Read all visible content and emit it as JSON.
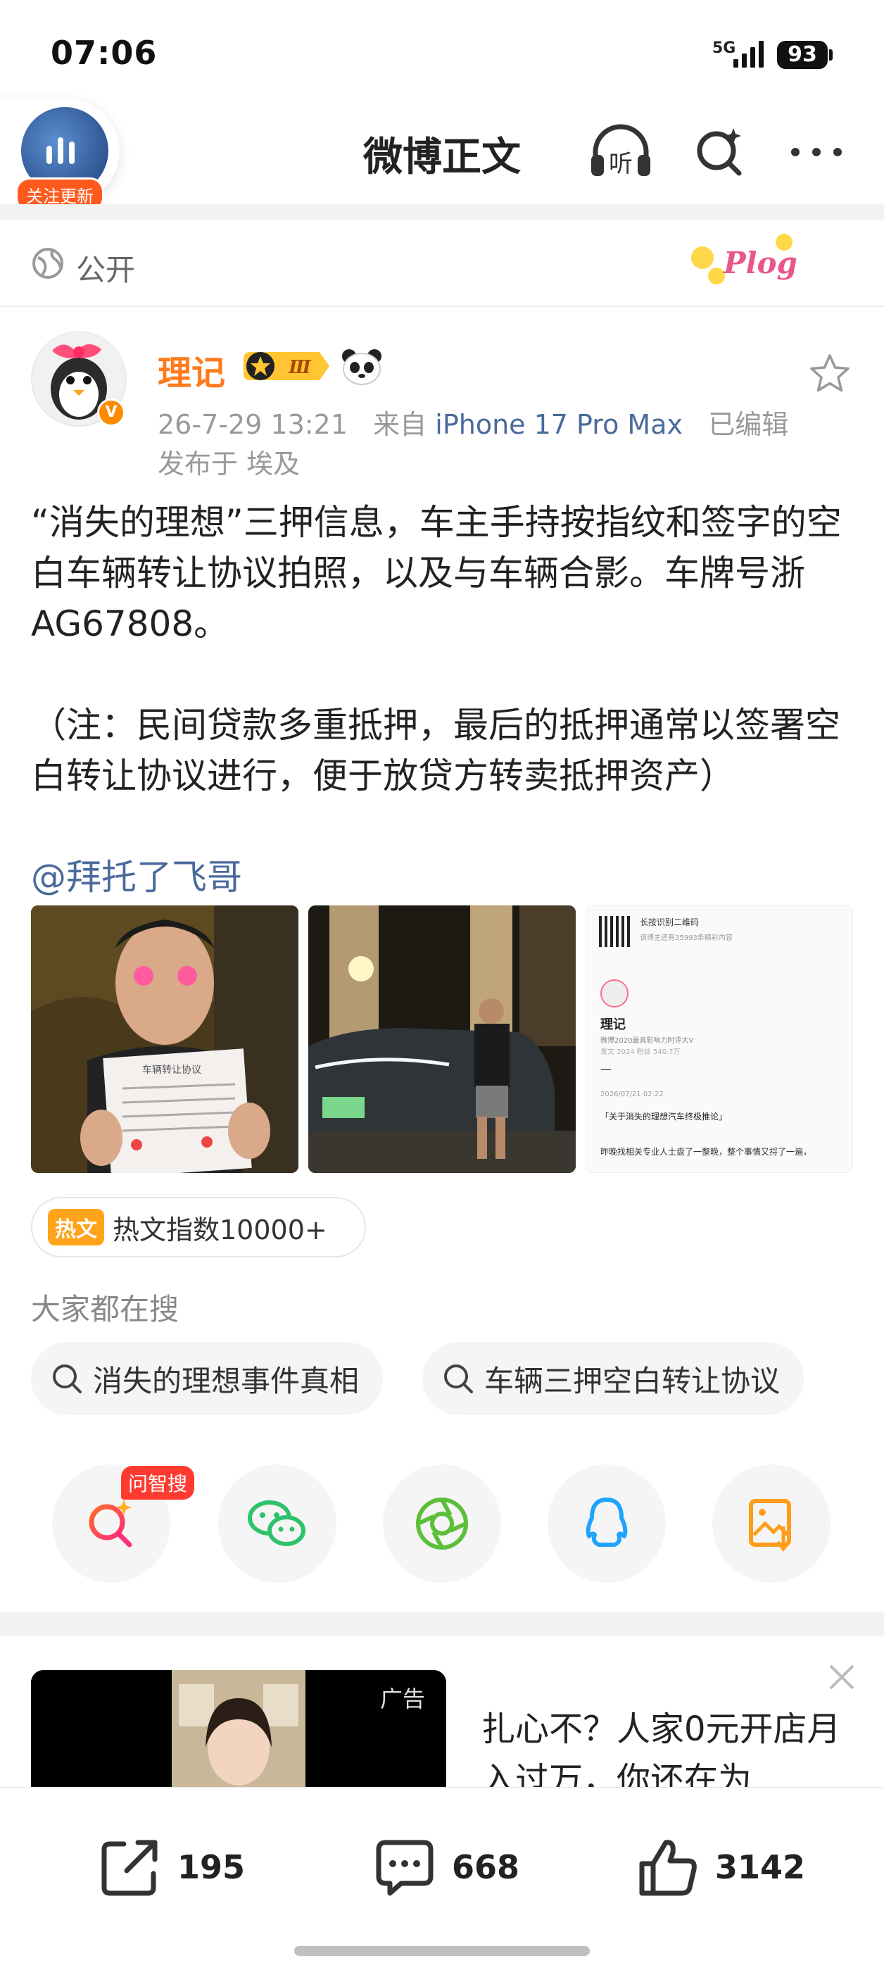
{
  "status_bar": {
    "time": "07:06",
    "network": "5G",
    "battery": "93"
  },
  "nav": {
    "title": "微博正文",
    "follow_badge": "关注更新",
    "icons": [
      "listen-icon",
      "search-ai-icon",
      "more-icon"
    ]
  },
  "visibility": {
    "label": "公开",
    "sticker_text": "Plog"
  },
  "author": {
    "name": "理记",
    "vip_level": "Ⅲ",
    "meta": {
      "date": "26-7-29 13:21",
      "source_prefix": "来自",
      "device": "iPhone 17 Pro Max",
      "edited": "已编辑",
      "location": "发布于 埃及"
    }
  },
  "post": {
    "paragraph1": "“消失的理想”三押信息，车主手持按指纹和签字的空白车辆转让协议拍照，以及与车辆合影。车牌号浙AG67808。",
    "paragraph2": "（注：民间贷款多重抵押，最后的抵押通常以签署空白转让协议进行，便于放贷方转卖抵押资产）",
    "mention": "@拜托了飞哥",
    "image3": {
      "qr_title": "长按识别二维码",
      "qr_subtitle": "该博主还有35993条精彩内容",
      "name": "理记",
      "line1": "微博2020最具影响力时评大V",
      "line2": "发文 2024   粉丝 540.7万",
      "dash": "—",
      "date": "2026/07/21 02:22",
      "headline": "「关于消失的理想汽车终极推论」",
      "body": "昨晚找相关专业人士盘了一整晚，整个事情又捋了一遍，"
    },
    "doc_title": "车辆转让协议"
  },
  "hot": {
    "tag": "热文",
    "text": "热文指数10000+"
  },
  "search": {
    "title": "大家都在搜",
    "chips": [
      "消失的理想事件真相",
      "车辆三押空白转让协议"
    ]
  },
  "share": {
    "badge": "问智搜",
    "buttons": [
      "ai-search-icon",
      "wechat-icon",
      "moments-icon",
      "qq-icon",
      "save-image-icon"
    ]
  },
  "ad": {
    "label": "广告",
    "title": "扎心不？人家0元开店月入过万，你还在为..."
  },
  "actions": {
    "repost": "195",
    "comment": "668",
    "like": "3142"
  }
}
